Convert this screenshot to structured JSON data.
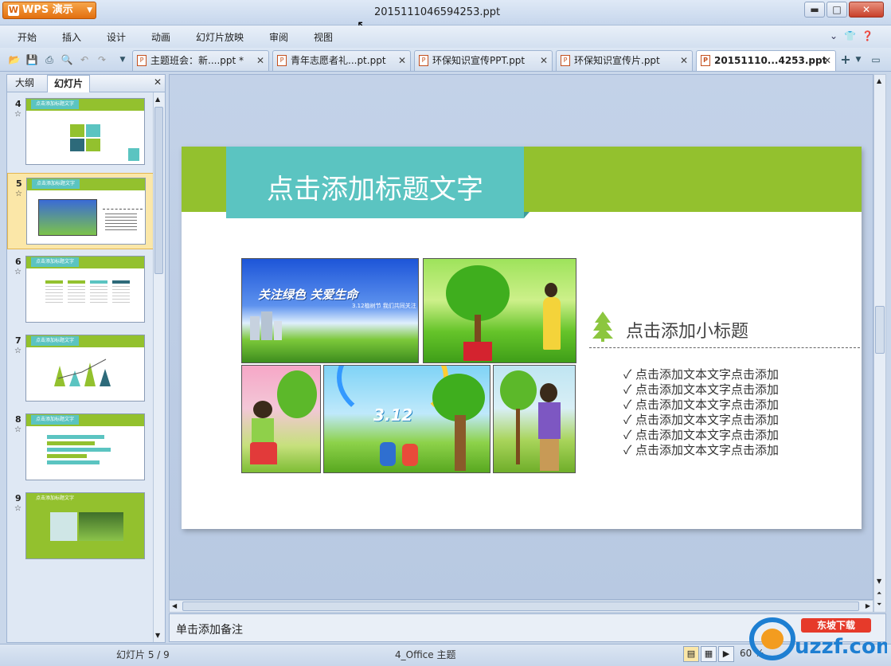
{
  "app": {
    "button_label": "WPS 演示",
    "window_title": "2015111046594253.ppt"
  },
  "window_controls": {
    "minimize": "▬",
    "maximize": "□",
    "close": "✕"
  },
  "menu": {
    "items": [
      "开始",
      "插入",
      "设计",
      "动画",
      "幻灯片放映",
      "审阅",
      "视图"
    ],
    "right_icons": [
      "chevron-down-icon",
      "shirt-icon",
      "help-icon"
    ]
  },
  "toolbar": {
    "icons": [
      "open-folder-icon",
      "save-icon",
      "print-icon",
      "print-preview-icon",
      "undo-icon",
      "redo-icon",
      "dropdown-icon"
    ]
  },
  "tabs": [
    {
      "label": "主题班会：新....ppt *",
      "active": false
    },
    {
      "label": "青年志愿者礼...pt.ppt",
      "active": false
    },
    {
      "label": "环保知识宣传PPT.ppt",
      "active": false
    },
    {
      "label": "环保知识宣传片.ppt",
      "active": false
    },
    {
      "label": "20151110...4253.ppt",
      "active": true
    }
  ],
  "tab_close": "✕",
  "tab_add": "+",
  "sidebar": {
    "tab_outline": "大纲",
    "tab_slides": "幻灯片",
    "close": "✕",
    "thumbnails": [
      {
        "number": "4",
        "star": "☆",
        "selected": false,
        "header": "点击添加标题文字"
      },
      {
        "number": "5",
        "star": "☆",
        "selected": true,
        "header": "点击添加标题文字"
      },
      {
        "number": "6",
        "star": "☆",
        "selected": false,
        "header": "点击添加标题文字"
      },
      {
        "number": "7",
        "star": "☆",
        "selected": false,
        "header": "点击添加标题文字"
      },
      {
        "number": "8",
        "star": "☆",
        "selected": false,
        "header": "点击添加标题文字"
      },
      {
        "number": "9",
        "star": "☆",
        "selected": false,
        "header": "点击添加标题文字"
      }
    ]
  },
  "slide": {
    "title": "点击添加标题文字",
    "subtitle": "点击添加小标题",
    "photo_caption_title": "关注绿色 关爱生命",
    "photo_caption_sub": "3.12植树节 我们共同关注",
    "photo_312": "3.12",
    "bullets": [
      "点击添加文本文字点击添加",
      "点击添加文本文字点击添加",
      "点击添加文本文字点击添加",
      "点击添加文本文字点击添加",
      "点击添加文本文字点击添加",
      "点击添加文本文字点击添加"
    ],
    "check": "✓",
    "colors": {
      "green": "#93c12e",
      "teal": "#5bc4c1"
    }
  },
  "notes": {
    "placeholder": "单击添加备注"
  },
  "status": {
    "slide_counter": "幻灯片 5 / 9",
    "theme": "4_Office 主题",
    "zoom": "60 %"
  },
  "watermark": {
    "text": "uzzf.com",
    "sub": "东坡下载"
  }
}
